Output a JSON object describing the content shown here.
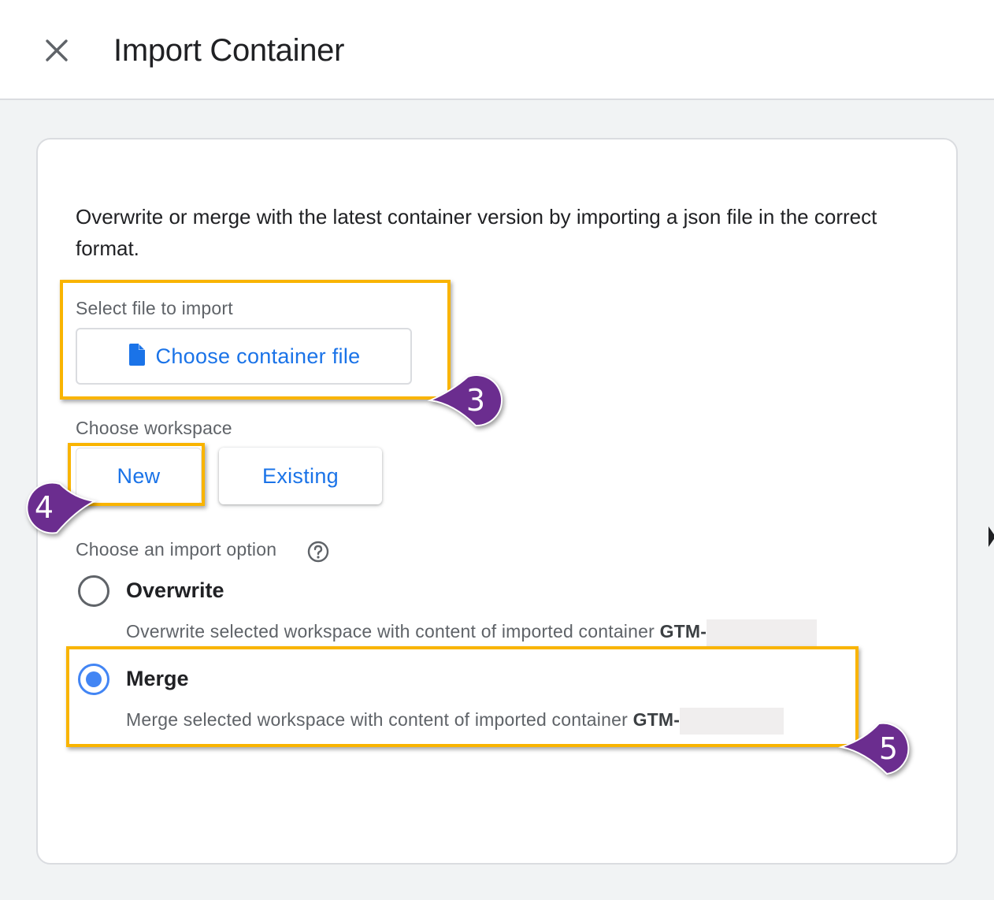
{
  "header": {
    "title": "Import Container",
    "close_icon": "close-icon"
  },
  "description": "Overwrite or merge with the latest container version by importing a json file in the correct format.",
  "file_select": {
    "label": "Select file to import",
    "button_label": "Choose container file",
    "icon": "file-icon"
  },
  "workspace": {
    "label": "Choose workspace",
    "options": [
      "New",
      "Existing"
    ],
    "selected": "New"
  },
  "import_option": {
    "label": "Choose an import option",
    "help_icon": "help-icon",
    "selected": "Merge",
    "options": [
      {
        "title": "Overwrite",
        "description": "Overwrite selected workspace with content of imported container",
        "container_prefix": "GTM-"
      },
      {
        "title": "Merge",
        "description": "Merge selected workspace with content of imported container",
        "container_prefix": "GTM-"
      }
    ]
  },
  "annotations": {
    "step_3": "3",
    "step_4": "4",
    "step_5": "5"
  },
  "colors": {
    "accent": "#1a73e8",
    "radio": "#4285f4",
    "highlight": "#f9b400",
    "badge": "#6b2d8f"
  }
}
